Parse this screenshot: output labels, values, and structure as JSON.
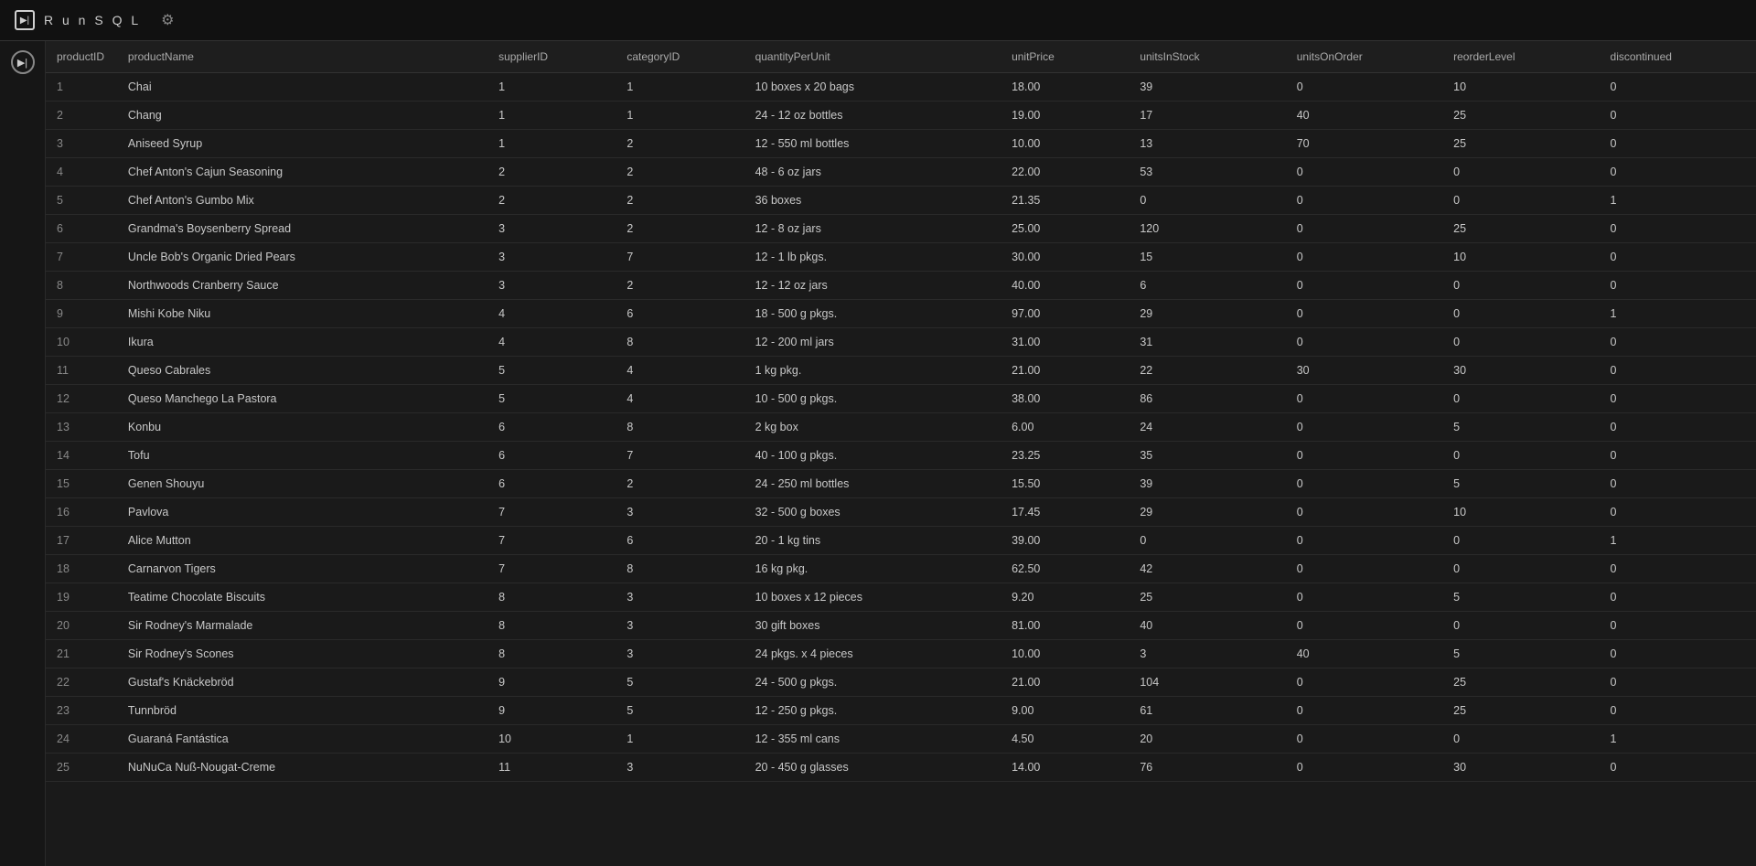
{
  "topbar": {
    "app_name": "R u n S Q L",
    "logo_text": "▶|"
  },
  "table": {
    "columns": [
      {
        "key": "productID",
        "label": "productID",
        "class": "col-productid"
      },
      {
        "key": "productName",
        "label": "productName",
        "class": "col-productname"
      },
      {
        "key": "supplierID",
        "label": "supplierID",
        "class": "col-supplierid"
      },
      {
        "key": "categoryID",
        "label": "categoryID",
        "class": "col-categoryid"
      },
      {
        "key": "quantityPerUnit",
        "label": "quantityPerUnit",
        "class": "col-quantityperunit"
      },
      {
        "key": "unitPrice",
        "label": "unitPrice",
        "class": "col-unitprice"
      },
      {
        "key": "unitsInStock",
        "label": "unitsInStock",
        "class": "col-unitsinstock"
      },
      {
        "key": "unitsOnOrder",
        "label": "unitsOnOrder",
        "class": "col-unitsonorder"
      },
      {
        "key": "reorderLevel",
        "label": "reorderLevel",
        "class": "col-reorderlevel"
      },
      {
        "key": "discontinued",
        "label": "discontinued",
        "class": "col-discontinued"
      }
    ],
    "rows": [
      {
        "productID": "1",
        "productName": "Chai",
        "supplierID": "1",
        "categoryID": "1",
        "quantityPerUnit": "10 boxes x 20 bags",
        "unitPrice": "18.00",
        "unitsInStock": "39",
        "unitsOnOrder": "0",
        "reorderLevel": "10",
        "discontinued": "0"
      },
      {
        "productID": "2",
        "productName": "Chang",
        "supplierID": "1",
        "categoryID": "1",
        "quantityPerUnit": "24 - 12 oz bottles",
        "unitPrice": "19.00",
        "unitsInStock": "17",
        "unitsOnOrder": "40",
        "reorderLevel": "25",
        "discontinued": "0"
      },
      {
        "productID": "3",
        "productName": "Aniseed Syrup",
        "supplierID": "1",
        "categoryID": "2",
        "quantityPerUnit": "12 - 550 ml bottles",
        "unitPrice": "10.00",
        "unitsInStock": "13",
        "unitsOnOrder": "70",
        "reorderLevel": "25",
        "discontinued": "0"
      },
      {
        "productID": "4",
        "productName": "Chef Anton's Cajun Seasoning",
        "supplierID": "2",
        "categoryID": "2",
        "quantityPerUnit": "48 - 6 oz jars",
        "unitPrice": "22.00",
        "unitsInStock": "53",
        "unitsOnOrder": "0",
        "reorderLevel": "0",
        "discontinued": "0"
      },
      {
        "productID": "5",
        "productName": "Chef Anton's Gumbo Mix",
        "supplierID": "2",
        "categoryID": "2",
        "quantityPerUnit": "36 boxes",
        "unitPrice": "21.35",
        "unitsInStock": "0",
        "unitsOnOrder": "0",
        "reorderLevel": "0",
        "discontinued": "1"
      },
      {
        "productID": "6",
        "productName": "Grandma's Boysenberry Spread",
        "supplierID": "3",
        "categoryID": "2",
        "quantityPerUnit": "12 - 8 oz jars",
        "unitPrice": "25.00",
        "unitsInStock": "120",
        "unitsOnOrder": "0",
        "reorderLevel": "25",
        "discontinued": "0"
      },
      {
        "productID": "7",
        "productName": "Uncle Bob's Organic Dried Pears",
        "supplierID": "3",
        "categoryID": "7",
        "quantityPerUnit": "12 - 1 lb pkgs.",
        "unitPrice": "30.00",
        "unitsInStock": "15",
        "unitsOnOrder": "0",
        "reorderLevel": "10",
        "discontinued": "0"
      },
      {
        "productID": "8",
        "productName": "Northwoods Cranberry Sauce",
        "supplierID": "3",
        "categoryID": "2",
        "quantityPerUnit": "12 - 12 oz jars",
        "unitPrice": "40.00",
        "unitsInStock": "6",
        "unitsOnOrder": "0",
        "reorderLevel": "0",
        "discontinued": "0"
      },
      {
        "productID": "9",
        "productName": "Mishi Kobe Niku",
        "supplierID": "4",
        "categoryID": "6",
        "quantityPerUnit": "18 - 500 g pkgs.",
        "unitPrice": "97.00",
        "unitsInStock": "29",
        "unitsOnOrder": "0",
        "reorderLevel": "0",
        "discontinued": "1"
      },
      {
        "productID": "10",
        "productName": "Ikura",
        "supplierID": "4",
        "categoryID": "8",
        "quantityPerUnit": "12 - 200 ml jars",
        "unitPrice": "31.00",
        "unitsInStock": "31",
        "unitsOnOrder": "0",
        "reorderLevel": "0",
        "discontinued": "0"
      },
      {
        "productID": "11",
        "productName": "Queso Cabrales",
        "supplierID": "5",
        "categoryID": "4",
        "quantityPerUnit": "1 kg pkg.",
        "unitPrice": "21.00",
        "unitsInStock": "22",
        "unitsOnOrder": "30",
        "reorderLevel": "30",
        "discontinued": "0"
      },
      {
        "productID": "12",
        "productName": "Queso Manchego La Pastora",
        "supplierID": "5",
        "categoryID": "4",
        "quantityPerUnit": "10 - 500 g pkgs.",
        "unitPrice": "38.00",
        "unitsInStock": "86",
        "unitsOnOrder": "0",
        "reorderLevel": "0",
        "discontinued": "0"
      },
      {
        "productID": "13",
        "productName": "Konbu",
        "supplierID": "6",
        "categoryID": "8",
        "quantityPerUnit": "2 kg box",
        "unitPrice": "6.00",
        "unitsInStock": "24",
        "unitsOnOrder": "0",
        "reorderLevel": "5",
        "discontinued": "0"
      },
      {
        "productID": "14",
        "productName": "Tofu",
        "supplierID": "6",
        "categoryID": "7",
        "quantityPerUnit": "40 - 100 g pkgs.",
        "unitPrice": "23.25",
        "unitsInStock": "35",
        "unitsOnOrder": "0",
        "reorderLevel": "0",
        "discontinued": "0"
      },
      {
        "productID": "15",
        "productName": "Genen Shouyu",
        "supplierID": "6",
        "categoryID": "2",
        "quantityPerUnit": "24 - 250 ml bottles",
        "unitPrice": "15.50",
        "unitsInStock": "39",
        "unitsOnOrder": "0",
        "reorderLevel": "5",
        "discontinued": "0"
      },
      {
        "productID": "16",
        "productName": "Pavlova",
        "supplierID": "7",
        "categoryID": "3",
        "quantityPerUnit": "32 - 500 g boxes",
        "unitPrice": "17.45",
        "unitsInStock": "29",
        "unitsOnOrder": "0",
        "reorderLevel": "10",
        "discontinued": "0"
      },
      {
        "productID": "17",
        "productName": "Alice Mutton",
        "supplierID": "7",
        "categoryID": "6",
        "quantityPerUnit": "20 - 1 kg tins",
        "unitPrice": "39.00",
        "unitsInStock": "0",
        "unitsOnOrder": "0",
        "reorderLevel": "0",
        "discontinued": "1"
      },
      {
        "productID": "18",
        "productName": "Carnarvon Tigers",
        "supplierID": "7",
        "categoryID": "8",
        "quantityPerUnit": "16 kg pkg.",
        "unitPrice": "62.50",
        "unitsInStock": "42",
        "unitsOnOrder": "0",
        "reorderLevel": "0",
        "discontinued": "0"
      },
      {
        "productID": "19",
        "productName": "Teatime Chocolate Biscuits",
        "supplierID": "8",
        "categoryID": "3",
        "quantityPerUnit": "10 boxes x 12 pieces",
        "unitPrice": "9.20",
        "unitsInStock": "25",
        "unitsOnOrder": "0",
        "reorderLevel": "5",
        "discontinued": "0"
      },
      {
        "productID": "20",
        "productName": "Sir Rodney's Marmalade",
        "supplierID": "8",
        "categoryID": "3",
        "quantityPerUnit": "30 gift boxes",
        "unitPrice": "81.00",
        "unitsInStock": "40",
        "unitsOnOrder": "0",
        "reorderLevel": "0",
        "discontinued": "0"
      },
      {
        "productID": "21",
        "productName": "Sir Rodney's Scones",
        "supplierID": "8",
        "categoryID": "3",
        "quantityPerUnit": "24 pkgs. x 4 pieces",
        "unitPrice": "10.00",
        "unitsInStock": "3",
        "unitsOnOrder": "40",
        "reorderLevel": "5",
        "discontinued": "0"
      },
      {
        "productID": "22",
        "productName": "Gustaf's Knäckebröd",
        "supplierID": "9",
        "categoryID": "5",
        "quantityPerUnit": "24 - 500 g pkgs.",
        "unitPrice": "21.00",
        "unitsInStock": "104",
        "unitsOnOrder": "0",
        "reorderLevel": "25",
        "discontinued": "0"
      },
      {
        "productID": "23",
        "productName": "Tunnbröd",
        "supplierID": "9",
        "categoryID": "5",
        "quantityPerUnit": "12 - 250 g pkgs.",
        "unitPrice": "9.00",
        "unitsInStock": "61",
        "unitsOnOrder": "0",
        "reorderLevel": "25",
        "discontinued": "0"
      },
      {
        "productID": "24",
        "productName": "Guaraná Fantástica",
        "supplierID": "10",
        "categoryID": "1",
        "quantityPerUnit": "12 - 355 ml cans",
        "unitPrice": "4.50",
        "unitsInStock": "20",
        "unitsOnOrder": "0",
        "reorderLevel": "0",
        "discontinued": "1"
      },
      {
        "productID": "25",
        "productName": "NuNuCa Nuß-Nougat-Creme",
        "supplierID": "11",
        "categoryID": "3",
        "quantityPerUnit": "20 - 450 g glasses",
        "unitPrice": "14.00",
        "unitsInStock": "76",
        "unitsOnOrder": "0",
        "reorderLevel": "30",
        "discontinued": "0"
      }
    ]
  },
  "run_button": {
    "label": "▶|"
  }
}
